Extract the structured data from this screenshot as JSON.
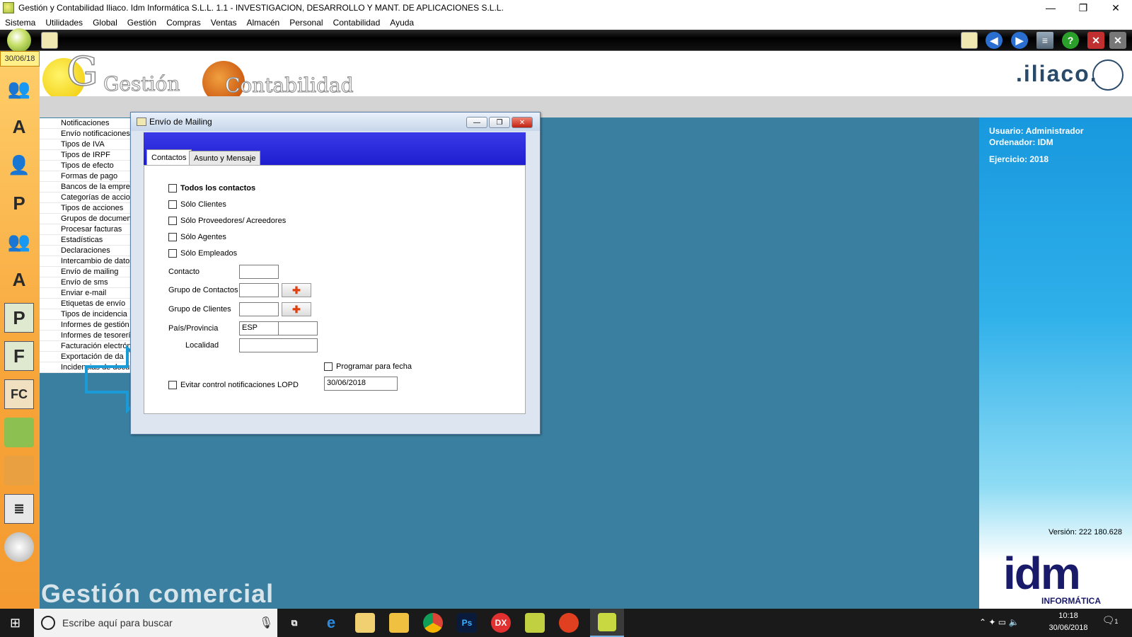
{
  "window": {
    "title": "Gestión y Contabilidad Iliaco. Idm Informática S.L.L. 1.1 - INVESTIGACION, DESARROLLO Y MANT. DE APLICACIONES S.L.L.",
    "minimize": "—",
    "restore": "❐",
    "close": "✕"
  },
  "menu": [
    "Sistema",
    "Utilidades",
    "Global",
    "Gestión",
    "Compras",
    "Ventas",
    "Almacén",
    "Personal",
    "Contabilidad",
    "Ayuda"
  ],
  "sidebar": {
    "date": "30/06/18",
    "icons": [
      "people-icon",
      "book-a-icon",
      "user-icon",
      "user-p-icon",
      "users-icon",
      "user-a-icon",
      "p-icon",
      "f-icon",
      "fc-icon",
      "bag-green-icon",
      "bag-orange-icon",
      "notebook-icon",
      "disc-icon"
    ]
  },
  "header": {
    "logo_gestion": "Gestión",
    "logo_contabilidad": "Contabilidad",
    "brand": ".iliaco."
  },
  "navlist": [
    "Notificaciones",
    "Envío notificaciones",
    "Tipos de IVA",
    "Tipos de IRPF",
    "Tipos de efecto",
    "Formas de pago",
    "Bancos de la empres",
    "Categorías de accion",
    "Tipos de acciones",
    "Grupos de documen",
    "Procesar facturas",
    "Estadísticas",
    "Declaraciones",
    "Intercambio de datos",
    "Envío de mailing",
    "Envío de sms",
    "Enviar e-mail",
    "Etiquetas de envío",
    "Tipos de incidencia",
    "Informes de gestión",
    "Informes de tesorería",
    "Facturación electrón",
    "Exportación de da",
    "Incidencias de docu"
  ],
  "rightpanel": {
    "usuario": "Usuario: Administrador",
    "ordenador": "Ordenador: IDM",
    "ejercicio": "Ejercicio: 2018",
    "version": "Versión: 222 180.628",
    "idm": "idm",
    "informatica": "INFORMÁTICA"
  },
  "footer_text": "Gestión comercial",
  "dialog": {
    "title": "Envío de Mailing",
    "tabs": [
      "Contactos",
      "Asunto y Mensaje"
    ],
    "checkboxes": {
      "todos": "Todos los contactos",
      "clientes": "Sólo Clientes",
      "proveedores": "Sólo Proveedores/ Acreedores",
      "agentes": "Sólo Agentes",
      "empleados": "Sólo Empleados",
      "lopd": "Evitar control notificaciones LOPD",
      "programar": "Programar para fecha"
    },
    "labels": {
      "contacto": "Contacto",
      "grupo_contactos": "Grupo de Contactos",
      "grupo_clientes": "Grupo de Clientes",
      "pais_provincia": "País/Provincia",
      "localidad": "Localidad"
    },
    "values": {
      "pais": "ESP",
      "fecha": "30/06/2018"
    }
  },
  "taskbar": {
    "search_placeholder": "Escribe aquí para buscar",
    "time": "10:18",
    "date": "30/06/2018",
    "notif_count": "1"
  },
  "colors": {
    "accent_blue": "#1e1ed0",
    "arrow": "#1a9bd7",
    "sidebar_orange": "#f7a438"
  }
}
